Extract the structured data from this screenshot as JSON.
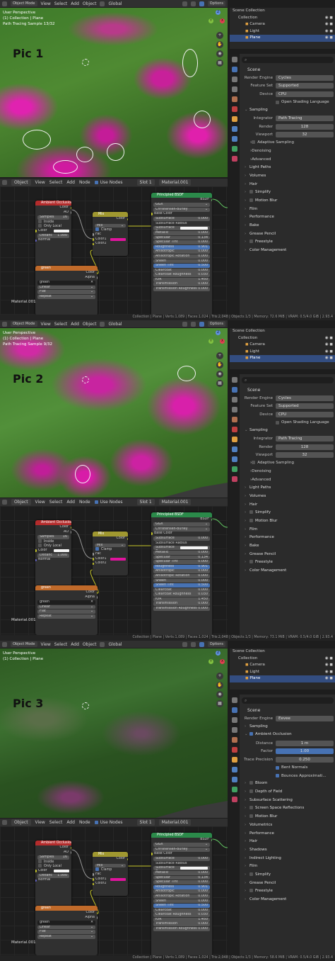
{
  "header": {
    "mode": "Object Mode",
    "menu": [
      "View",
      "Select",
      "Add",
      "Object"
    ],
    "transform": "Global",
    "options": "Options"
  },
  "viewport": {
    "perspective": "User Perspective",
    "collection": "(1) Collection | Plane"
  },
  "node_editor": {
    "object": "Object",
    "menu": [
      "View",
      "Select",
      "Add",
      "Node"
    ],
    "use_nodes": "Use Nodes",
    "slot": "Slot 1",
    "material": "Material.001",
    "ao_node": {
      "title": "Ambient Occlusion",
      "out_color": "Color",
      "out_ao": "AO",
      "samples_label": "Samples",
      "samples": "16",
      "inside": "Inside",
      "only_local": "Only Local",
      "in_color": "Color",
      "distance_label": "Distanc",
      "distance": "1.000",
      "normal": "Normal"
    },
    "mix_node": {
      "title": "Mix",
      "out_color": "Color",
      "mode": "Mix",
      "clamp": "Clamp",
      "fac": "Fac",
      "color1": "Color1",
      "color2": "Color2"
    },
    "tex_node": {
      "title": "green",
      "out_color": "Color",
      "out_alpha": "Alpha",
      "image": "green",
      "interp": "Linear",
      "proj": "Flat",
      "ext": "Repeat"
    },
    "bsdf_node": {
      "title": "Principled BSDF",
      "out": "BSDF",
      "dist": "GGX",
      "sss_method": "Christensen-Burley",
      "base_color": "Base Color",
      "rows": [
        {
          "k": "Subsurface",
          "v": "0.000"
        },
        {
          "k": "Subsurface Radius",
          "v": ""
        },
        {
          "k": "Subsurface C...",
          "v": ""
        },
        {
          "k": "Metallic",
          "v": "0.000"
        },
        {
          "k": "Specular",
          "v": "0.134"
        },
        {
          "k": "Specular Tint",
          "v": "0.000"
        },
        {
          "k": "Roughness",
          "v": "0.901"
        },
        {
          "k": "Anisotropic",
          "v": "0.000"
        },
        {
          "k": "Anisotropic Rotation",
          "v": "0.000"
        },
        {
          "k": "Sheen",
          "v": "0.000"
        },
        {
          "k": "Sheen Tint",
          "v": "0.500"
        },
        {
          "k": "Clearcoat",
          "v": "0.000"
        },
        {
          "k": "Clearcoat Roughness",
          "v": "0.030"
        },
        {
          "k": "IOR",
          "v": "1.450"
        },
        {
          "k": "Transmission",
          "v": "0.000"
        },
        {
          "k": "Transmission Roughness",
          "v": "0.000"
        }
      ]
    }
  },
  "outliner": {
    "scene_collection": "Scene Collection",
    "items": [
      "Collection",
      "Camera",
      "Light",
      "Plane"
    ]
  },
  "properties": {
    "scene": "Scene",
    "render_engine_label": "Render Engine",
    "feature_set_label": "Feature Set",
    "device_label": "Device",
    "open_shading": "Open Shading Language",
    "sampling": "Sampling",
    "integrator_label": "Integrator",
    "integrator": "Path Tracing",
    "render_label": "Render",
    "render_samples": "128",
    "viewport_label": "Viewport",
    "viewport_samples": "32",
    "cycles_subs": [
      "Adaptive Sampling",
      "Denoising",
      "Advanced"
    ],
    "cycles_sections": [
      "Light Paths",
      "Volumes",
      "Hair",
      "Simplify",
      "Motion Blur",
      "Film",
      "Performance",
      "Bake",
      "Grease Pencil",
      "Freestyle",
      "Color Management"
    ],
    "eevee": {
      "engine": "Eevee",
      "sampling": "Sampling",
      "ao": "Ambient Occlusion",
      "distance_label": "Distance",
      "distance": "1 m",
      "factor_label": "Factor",
      "factor": "1.00",
      "trace_label": "Trace Precision",
      "trace": "0.250",
      "bent": "Bent Normals",
      "bounces": "Bounces Approximati...",
      "sections": [
        "Bloom",
        "Depth of Field",
        "Subsurface Scattering",
        "Screen Space Reflections",
        "Motion Blur",
        "Volumetrics",
        "Performance",
        "Hair",
        "Shadows",
        "Indirect Lighting",
        "Film",
        "Simplify",
        "Grease Pencil",
        "Freestyle",
        "Color Management"
      ]
    }
  },
  "panels": [
    {
      "pic": "Pic 1",
      "sample": "Path Tracing Sample 13/32",
      "engine": "Cycles",
      "feature_set": "Supported",
      "device": "CPU",
      "status": "Collection | Plane | Verts:1,089 | Faces:1,024 | Tris:2,048 | Objects:1/3 | Memory: 72.6 MiB | VRAM: 0.5/4.0 GiB | 2.93.4"
    },
    {
      "pic": "Pic 2",
      "sample": "Path Tracing Sample 9/32",
      "engine": "Cycles",
      "feature_set": "Supported",
      "device": "CPU",
      "status": "Collection | Plane | Verts:1,089 | Faces:1,024 | Tris:2,048 | Objects:1/3 | Memory: 73.1 MiB | VRAM: 0.5/4.0 GiB | 2.93.4"
    },
    {
      "pic": "Pic 3",
      "sample": "",
      "engine": "Eevee",
      "status": "Collection | Plane | Verts:1,089 | Faces:1,024 | Tris:2,048 | Objects:1/3 | Memory: 58.6 MiB | VRAM: 0.5/4.0 GiB | 2.93.4"
    }
  ],
  "colors": {
    "accent": "#4772b3",
    "magenta": "#e0149e",
    "green": "#4a7a2c",
    "node_ao": "#b42c2c",
    "node_mix": "#a09830",
    "node_tex": "#c06a2a",
    "node_bsdf": "#2b8a4a"
  }
}
